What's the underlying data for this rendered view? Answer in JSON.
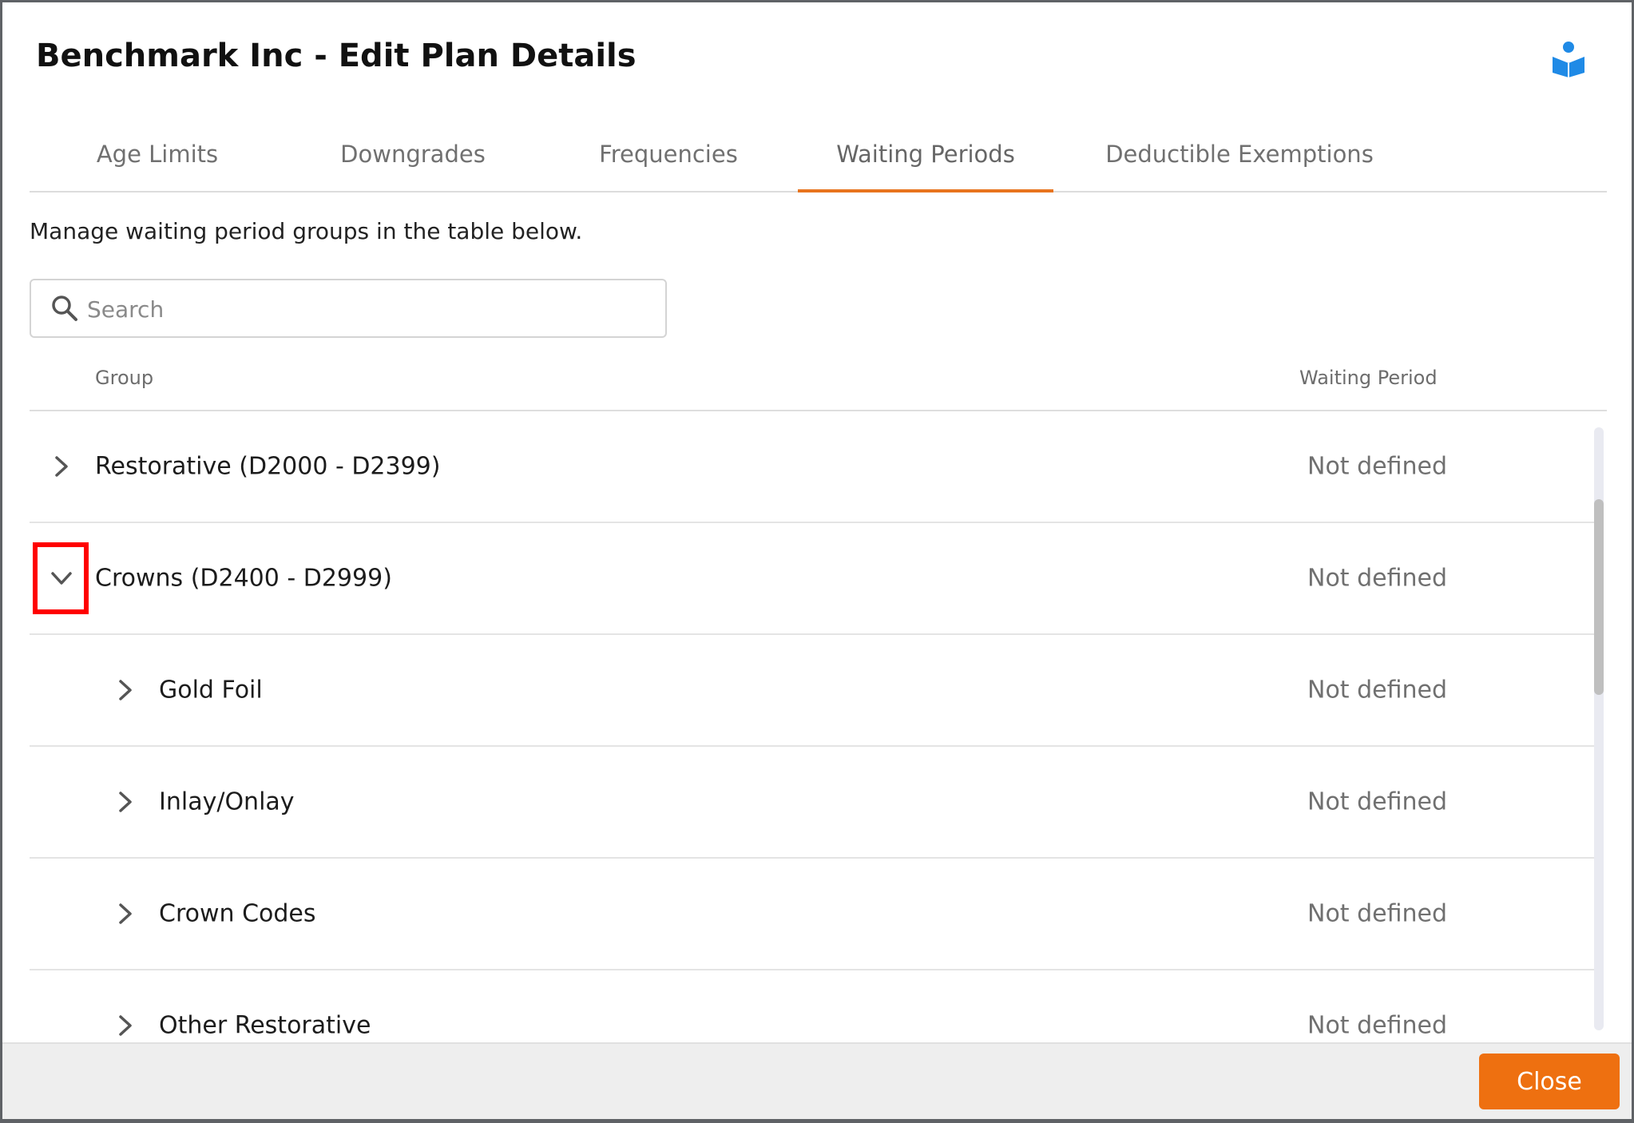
{
  "dialog": {
    "title": "Benchmark Inc - Edit Plan Details",
    "help_icon": "book-reader-icon",
    "accent_color": "#ee7010"
  },
  "tabs": [
    {
      "label": "Age Limits",
      "active": false
    },
    {
      "label": "Downgrades",
      "active": false
    },
    {
      "label": "Frequencies",
      "active": false
    },
    {
      "label": "Waiting Periods",
      "active": true
    },
    {
      "label": "Deductible Exemptions",
      "active": false
    }
  ],
  "intro_text": "Manage waiting period groups in the table below.",
  "search": {
    "placeholder": "Search",
    "value": ""
  },
  "table": {
    "columns": [
      "Group",
      "Waiting Period"
    ],
    "rows": [
      {
        "label": "Restorative (D2000 - D2399)",
        "value": "Not defined",
        "level": 0,
        "expanded": false
      },
      {
        "label": "Crowns (D2400 - D2999)",
        "value": "Not defined",
        "level": 0,
        "expanded": true,
        "highlighted": true
      },
      {
        "label": "Gold Foil",
        "value": "Not defined",
        "level": 1,
        "expanded": false
      },
      {
        "label": "Inlay/Onlay",
        "value": "Not defined",
        "level": 1,
        "expanded": false
      },
      {
        "label": "Crown Codes",
        "value": "Not defined",
        "level": 1,
        "expanded": false
      },
      {
        "label": "Other Restorative",
        "value": "Not defined",
        "level": 1,
        "expanded": false
      }
    ]
  },
  "footer": {
    "close_label": "Close"
  }
}
